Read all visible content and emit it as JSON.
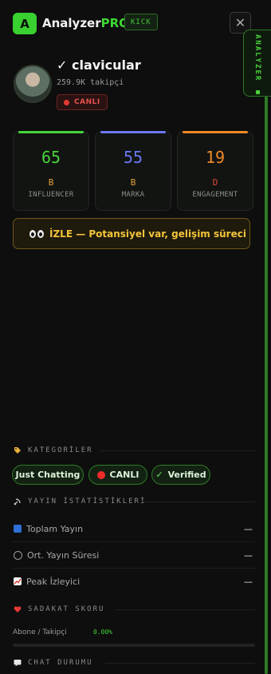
{
  "brand": {
    "badge": "A",
    "name": "Analyzer",
    "suffix": "PRO",
    "platform": "KICK",
    "close": "✕",
    "side_tab": "ANALYZER"
  },
  "profile": {
    "name_check": "✓",
    "username": "clavicular",
    "followers": "259.9K takipçi",
    "live": "CANLI"
  },
  "scores": [
    {
      "value": "65",
      "grade": "B",
      "label": "INFLUENCER",
      "color": "#46d43a",
      "grade_color": "#e6a13a"
    },
    {
      "value": "55",
      "grade": "B",
      "label": "MARKA",
      "color": "#6b78f2",
      "grade_color": "#e6a13a"
    },
    {
      "value": "19",
      "grade": "D",
      "label": "ENGAGEMENT",
      "color": "#f08a24",
      "grade_color": "#e0473c"
    }
  ],
  "verdict": {
    "text": "İZLE — Potansiyel var, gelişim süreci"
  },
  "categories": {
    "title": "KATEGORİLER",
    "tags": [
      "Just Chatting",
      "CANLI",
      "Verified"
    ],
    "verified_check": "✓"
  },
  "stream_stats": {
    "title": "YAYIN İSTATİSTİKLERİ",
    "rows": [
      {
        "label": "Toplam Yayın",
        "value": "—"
      },
      {
        "label": "Ort. Yayın Süresi",
        "value": "—"
      },
      {
        "label": "Peak İzleyici",
        "value": "—"
      }
    ]
  },
  "loyalty": {
    "title": "SADAKAT SKORU",
    "label": "Abone / Takipçi",
    "value": "0.00%",
    "fraction": 0.0
  },
  "chat": {
    "title": "CHAT DURUMU"
  },
  "colors": {
    "accent": "#39d12f",
    "live": "#e23a35",
    "verdict": "#f3c43a"
  }
}
